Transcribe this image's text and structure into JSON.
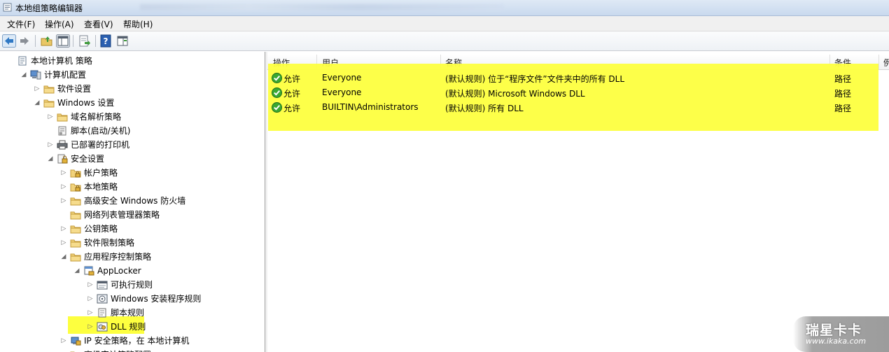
{
  "window": {
    "title": "本地组策略编辑器"
  },
  "menu": [
    {
      "label": "文件(F)"
    },
    {
      "label": "操作(A)"
    },
    {
      "label": "查看(V)"
    },
    {
      "label": "帮助(H)"
    }
  ],
  "toolbar": {
    "buttons": [
      {
        "icon": "back-arrow-icon"
      },
      {
        "icon": "forward-arrow-icon"
      },
      {
        "icon": "up-folder-icon"
      },
      {
        "icon": "show-hide-tree-icon"
      },
      {
        "icon": "export-list-icon"
      },
      {
        "icon": "help-icon"
      },
      {
        "icon": "properties-pane-icon"
      }
    ]
  },
  "tree": [
    {
      "label": "本地计算机 策略",
      "icon": "policy-doc-icon",
      "expander": ""
    },
    {
      "label": "计算机配置",
      "icon": "computer-icon",
      "expander": "open"
    },
    {
      "label": "软件设置",
      "icon": "folder-icon",
      "expander": "closed"
    },
    {
      "label": "Windows 设置",
      "icon": "folder-icon",
      "expander": "open"
    },
    {
      "label": "域名解析策略",
      "icon": "folder-icon",
      "expander": "closed"
    },
    {
      "label": "脚本(启动/关机)",
      "icon": "script-icon",
      "expander": ""
    },
    {
      "label": "已部署的打印机",
      "icon": "printer-icon",
      "expander": "closed"
    },
    {
      "label": "安全设置",
      "icon": "security-icon",
      "expander": "open"
    },
    {
      "label": "帐户策略",
      "icon": "lock-folder-icon",
      "expander": "closed"
    },
    {
      "label": "本地策略",
      "icon": "lock-folder-icon",
      "expander": "closed"
    },
    {
      "label": "高级安全 Windows 防火墙",
      "icon": "folder-icon",
      "expander": "closed"
    },
    {
      "label": "网络列表管理器策略",
      "icon": "folder-icon",
      "expander": ""
    },
    {
      "label": "公钥策略",
      "icon": "folder-icon",
      "expander": "closed"
    },
    {
      "label": "软件限制策略",
      "icon": "folder-icon",
      "expander": "closed"
    },
    {
      "label": "应用程序控制策略",
      "icon": "folder-icon",
      "expander": "open"
    },
    {
      "label": "AppLocker",
      "icon": "applocker-icon",
      "expander": "open"
    },
    {
      "label": "可执行规则",
      "icon": "executable-rules-icon",
      "expander": "closed"
    },
    {
      "label": "Windows 安装程序规则",
      "icon": "installer-rules-icon",
      "expander": "closed"
    },
    {
      "label": "脚本规则",
      "icon": "script-rules-icon",
      "expander": "closed"
    },
    {
      "label": "DLL 规则",
      "icon": "dll-rules-icon",
      "expander": "closed"
    },
    {
      "label": "IP 安全策略，在 本地计算机",
      "icon": "ip-security-icon",
      "expander": "closed"
    },
    {
      "label": "高级审计策略配置",
      "icon": "folder-icon",
      "expander": "closed"
    }
  ],
  "list": {
    "columns": [
      "操作",
      "用户",
      "名称",
      "条件",
      "例"
    ],
    "rows": [
      {
        "action": "允许",
        "user": "Everyone",
        "name": "(默认规则) 位于“程序文件”文件夹中的所有 DLL",
        "condition": "路径"
      },
      {
        "action": "允许",
        "user": "Everyone",
        "name": "(默认规则) Microsoft Windows DLL",
        "condition": "路径"
      },
      {
        "action": "允许",
        "user": "BUILTIN\\Administrators",
        "name": "(默认规则) 所有 DLL",
        "condition": "路径"
      }
    ]
  },
  "watermark": {
    "brand": "瑞星卡卡",
    "url": "www.ikaka.com"
  },
  "colors": {
    "highlight": "#fdff3f",
    "allow_check": "#3aa832"
  }
}
